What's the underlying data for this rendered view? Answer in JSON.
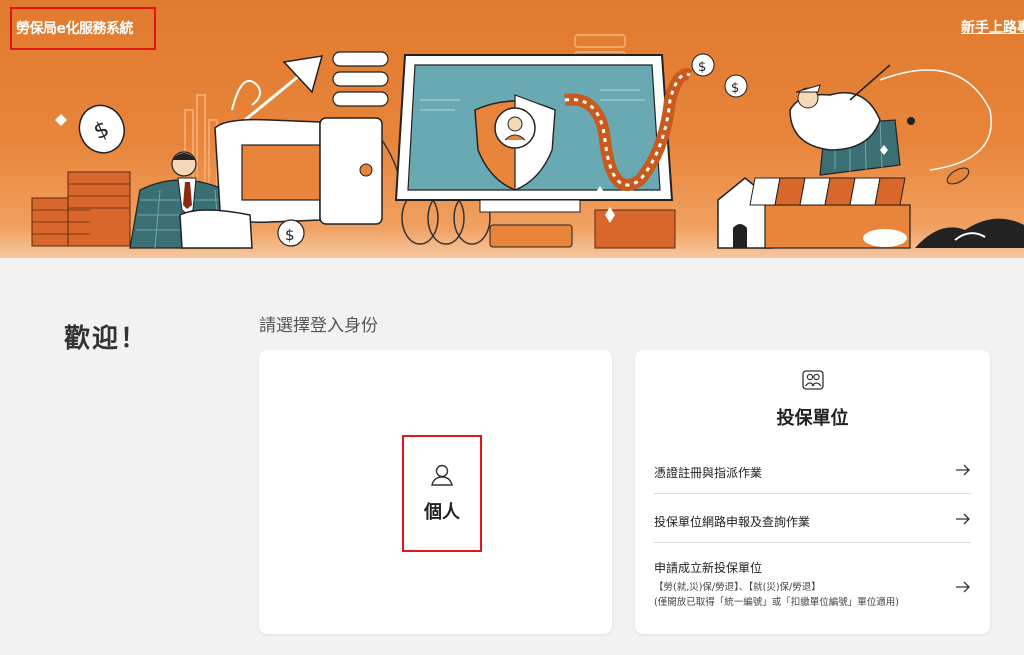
{
  "header": {
    "brand": "勞保局e化服務系統",
    "newbie_link": "新手上路專區"
  },
  "main": {
    "welcome": "歡迎！",
    "prompt": "請選擇登入身份",
    "personal": {
      "label": "個人",
      "icon": "user-icon"
    },
    "employer": {
      "title": "投保單位",
      "icon": "group-icon",
      "items": [
        {
          "label": "憑證註冊與指派作業"
        },
        {
          "label": "投保單位網路申報及查詢作業"
        },
        {
          "label": "申請成立新投保單位",
          "sub1": "【勞(就,災)保/勞退】、【就(災)保/勞退】",
          "sub2": "(僅開放已取得「統一編號」或「扣繳單位編號」單位適用)"
        }
      ]
    }
  },
  "colors": {
    "banner": "#e07a2e",
    "highlight_border": "#e0161b",
    "background": "#f2f2f2"
  }
}
